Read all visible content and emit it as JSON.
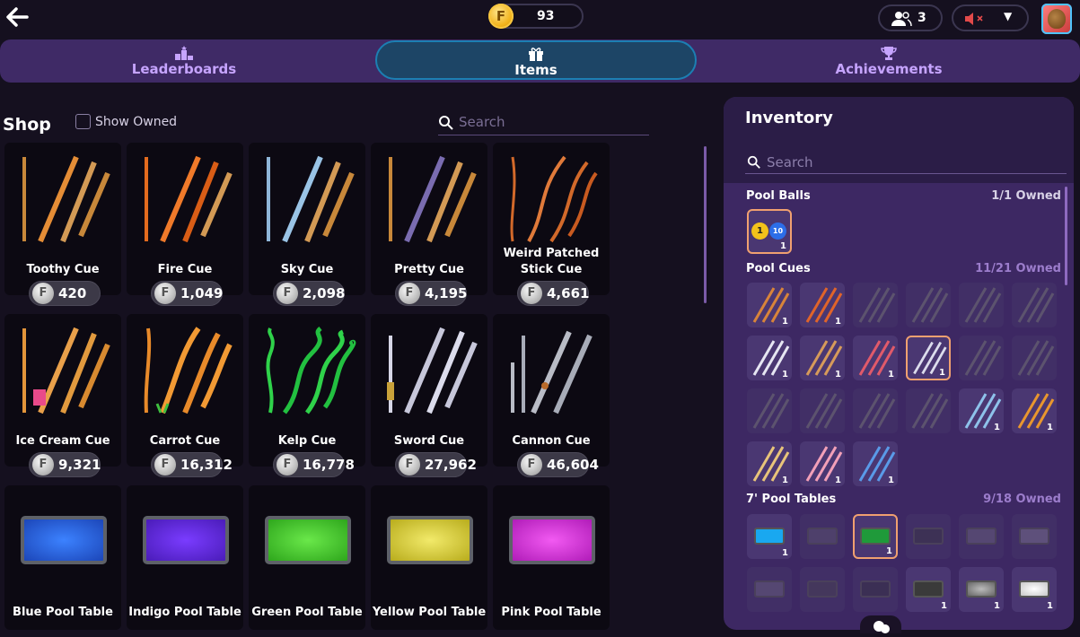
{
  "topbar": {
    "coins": "93",
    "friends_count": "3"
  },
  "tabs": [
    {
      "label": "Leaderboards"
    },
    {
      "label": "Items"
    },
    {
      "label": "Achievements"
    }
  ],
  "shop": {
    "title": "Shop",
    "show_owned_label": "Show Owned",
    "search_placeholder": "Search",
    "items": [
      {
        "name": "Toothy Cue",
        "price": "420"
      },
      {
        "name": "Fire Cue",
        "price": "1,049"
      },
      {
        "name": "Sky Cue",
        "price": "2,098"
      },
      {
        "name": "Pretty Cue",
        "price": "4,195"
      },
      {
        "name": "Weird Patched Stick Cue",
        "price": "4,661"
      },
      {
        "name": "Ice Cream Cue",
        "price": "9,321"
      },
      {
        "name": "Carrot Cue",
        "price": "16,312"
      },
      {
        "name": "Kelp Cue",
        "price": "16,778"
      },
      {
        "name": "Sword Cue",
        "price": "27,962"
      },
      {
        "name": "Cannon Cue",
        "price": "46,604"
      },
      {
        "name": "Blue Pool Table",
        "price": ""
      },
      {
        "name": "Indigo Pool Table",
        "price": ""
      },
      {
        "name": "Green Pool Table",
        "price": ""
      },
      {
        "name": "Yellow Pool Table",
        "price": ""
      },
      {
        "name": "Pink Pool Table",
        "price": ""
      }
    ]
  },
  "inventory": {
    "title": "Inventory",
    "search_placeholder": "Search",
    "sections": [
      {
        "name": "Pool Balls",
        "owned": "1/1 Owned"
      },
      {
        "name": "Pool Cues",
        "owned": "11/21 Owned"
      },
      {
        "name": "7' Pool Tables",
        "owned": "9/18 Owned"
      }
    ],
    "count_label": "1",
    "ball_numbers": [
      "1",
      "10"
    ]
  },
  "colors": {
    "tab_bar": "#3f2a66",
    "tab_active": "#1d4566",
    "inventory_bg": "#3d2863",
    "selected_border": "#f0a070"
  }
}
